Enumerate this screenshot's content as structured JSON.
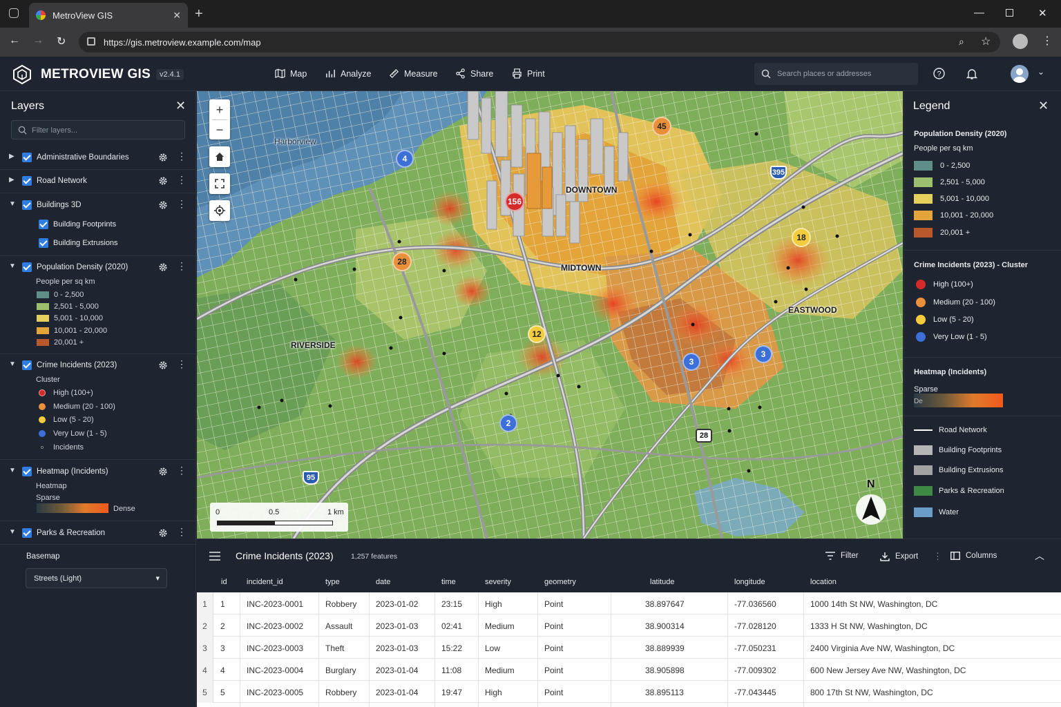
{
  "browser": {
    "tab_title": "MetroView GIS",
    "url": "https://gis.metroview.example.com/map"
  },
  "app": {
    "brand": "METROVIEW GIS",
    "version": "v2.4.1",
    "tools": [
      "Map",
      "Analyze",
      "Measure",
      "Share",
      "Print"
    ],
    "search_placeholder": "Search places or addresses"
  },
  "layers_panel": {
    "title": "Layers",
    "filter_placeholder": "Filter layers...",
    "layers": [
      {
        "name": "Administrative Boundaries",
        "expanded": false,
        "checked": true
      },
      {
        "name": "Road Network",
        "expanded": false,
        "checked": true
      },
      {
        "name": "Buildings 3D",
        "expanded": true,
        "checked": true,
        "children": [
          "Building Footprints",
          "Building Extrusions"
        ]
      },
      {
        "name": "Population Density (2020)",
        "expanded": true,
        "checked": true,
        "subtitle": "People per sq km",
        "classes": [
          "0 - 2,500",
          "2,501 - 5,000",
          "5,001 - 10,000",
          "10,001 - 20,000",
          "20,001 +"
        ]
      },
      {
        "name": "Crime Incidents (2023)",
        "expanded": true,
        "checked": true,
        "subtitle": "Cluster",
        "classes": [
          "High (100+)",
          "Medium (20 - 100)",
          "Low (5 - 20)",
          "Very Low (1 - 5)",
          "Incidents"
        ]
      },
      {
        "name": "Heatmap (Incidents)",
        "expanded": true,
        "checked": true,
        "subtitle": "Heatmap",
        "low": "Sparse",
        "high": "Dense"
      },
      {
        "name": "Parks & Recreation",
        "expanded": true,
        "checked": true
      }
    ],
    "basemap_label": "Basemap",
    "basemap_value": "Streets (Light)"
  },
  "map": {
    "places": [
      "Harborview",
      "DOWNTOWN",
      "MIDTOWN",
      "EASTWOOD",
      "RIVERSIDE"
    ],
    "clusters": [
      {
        "count": "156",
        "level": "high"
      },
      {
        "count": "45",
        "level": "medium"
      },
      {
        "count": "28",
        "level": "medium"
      },
      {
        "count": "18",
        "level": "low"
      },
      {
        "count": "12",
        "level": "low"
      },
      {
        "count": "4",
        "level": "very-low"
      },
      {
        "count": "3",
        "level": "very-low"
      },
      {
        "count": "3",
        "level": "very-low"
      },
      {
        "count": "2",
        "level": "very-low"
      }
    ],
    "route_shields": [
      "395",
      "95",
      "28"
    ],
    "scale": {
      "labels": [
        "0",
        "0.5",
        "1 km"
      ]
    },
    "north_label": "N"
  },
  "legend": {
    "title": "Legend",
    "population": {
      "title": "Population Density (2020)",
      "subtitle": "People per sq km",
      "classes": [
        {
          "label": "0 - 2,500",
          "color": "#5f8f86"
        },
        {
          "label": "2,501 - 5,000",
          "color": "#9cbf6e"
        },
        {
          "label": "5,001 - 10,000",
          "color": "#e4cf5c"
        },
        {
          "label": "10,001 - 20,000",
          "color": "#e3a53a"
        },
        {
          "label": "20,001 +",
          "color": "#b9582b"
        }
      ]
    },
    "crime": {
      "title": "Crime Incidents (2023) - Cluster",
      "classes": [
        {
          "label": "High (100+)",
          "color": "#d42a2a"
        },
        {
          "label": "Medium (20 - 100)",
          "color": "#e8913a"
        },
        {
          "label": "Low (5 - 20)",
          "color": "#f2cc3c"
        },
        {
          "label": "Very Low (1 - 5)",
          "color": "#3c6fd8"
        }
      ]
    },
    "heatmap": {
      "title": "Heatmap (Incidents)",
      "low": "Sparse",
      "high": "De"
    },
    "other": [
      {
        "label": "Road Network",
        "color": "#ffffff"
      },
      {
        "label": "Building Footprints",
        "color": "#b5b5b5"
      },
      {
        "label": "Building Extrusions",
        "color": "#a3a3a3"
      },
      {
        "label": "Parks & Recreation",
        "color": "#3e8a45"
      },
      {
        "label": "Water",
        "color": "#6a9ec9"
      }
    ]
  },
  "table": {
    "title": "Crime Incidents (2023)",
    "count": "1,257 features",
    "actions": [
      "Filter",
      "Export",
      "Columns"
    ],
    "columns": [
      "id",
      "incident_id",
      "type",
      "date",
      "time",
      "severity",
      "geometry",
      "latitude",
      "longitude",
      "location"
    ],
    "rows": [
      [
        "1",
        "INC-2023-0001",
        "Robbery",
        "2023-01-02",
        "23:15",
        "High",
        "Point",
        "38.897647",
        "-77.036560",
        "1000 14th St NW, Washington, DC"
      ],
      [
        "2",
        "INC-2023-0002",
        "Assault",
        "2023-01-03",
        "02:41",
        "Medium",
        "Point",
        "38.900314",
        "-77.028120",
        "1333 H St NW, Washington, DC"
      ],
      [
        "3",
        "INC-2023-0003",
        "Theft",
        "2023-01-03",
        "15:22",
        "Low",
        "Point",
        "38.889939",
        "-77.050231",
        "2400 Virginia Ave NW, Washington, DC"
      ],
      [
        "4",
        "INC-2023-0004",
        "Burglary",
        "2023-01-04",
        "11:08",
        "Medium",
        "Point",
        "38.905898",
        "-77.009302",
        "600 New Jersey Ave NW, Washington, DC"
      ],
      [
        "5",
        "INC-2023-0005",
        "Robbery",
        "2023-01-04",
        "19:47",
        "High",
        "Point",
        "38.895113",
        "-77.043445",
        "800 17th St NW, Washington, DC"
      ]
    ]
  }
}
